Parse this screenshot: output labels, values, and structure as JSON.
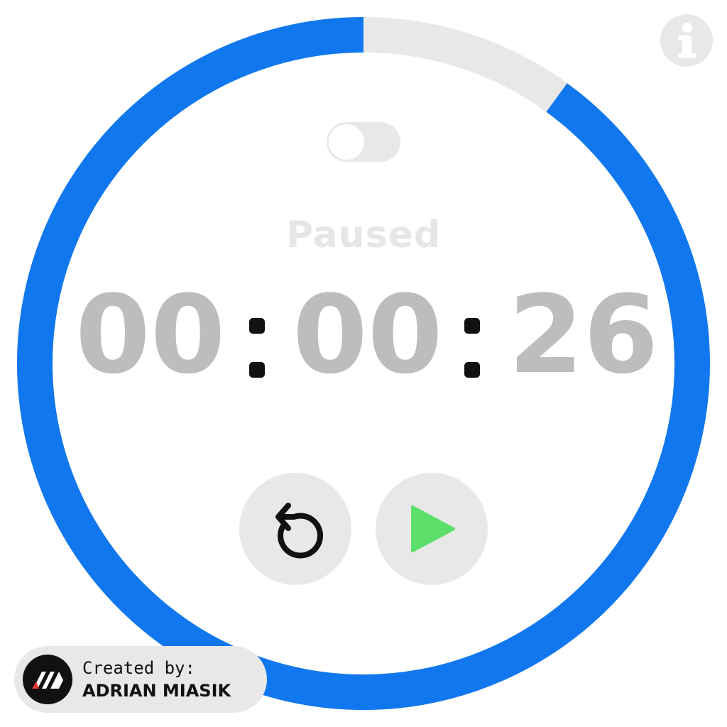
{
  "timer": {
    "status": "Paused",
    "hours": "00",
    "minutes": "00",
    "seconds": "26",
    "progress_fraction": 0.9,
    "progress_gap_fraction": 0.1
  },
  "toggle": {
    "on": false
  },
  "icons": {
    "info": "info-icon",
    "reset": "reset-icon",
    "play": "play-icon",
    "logo": "author-logo-icon"
  },
  "credit": {
    "label": "Created by:",
    "name": "ADRIAN MIASIK"
  },
  "colors": {
    "ring_progress": "#1177ee",
    "ring_track": "#e8e8e8",
    "button_bg": "#e8e8e8",
    "play_green": "#5ddf6b",
    "digits": "#bdbdbd",
    "status_text": "#e6e6e6"
  }
}
